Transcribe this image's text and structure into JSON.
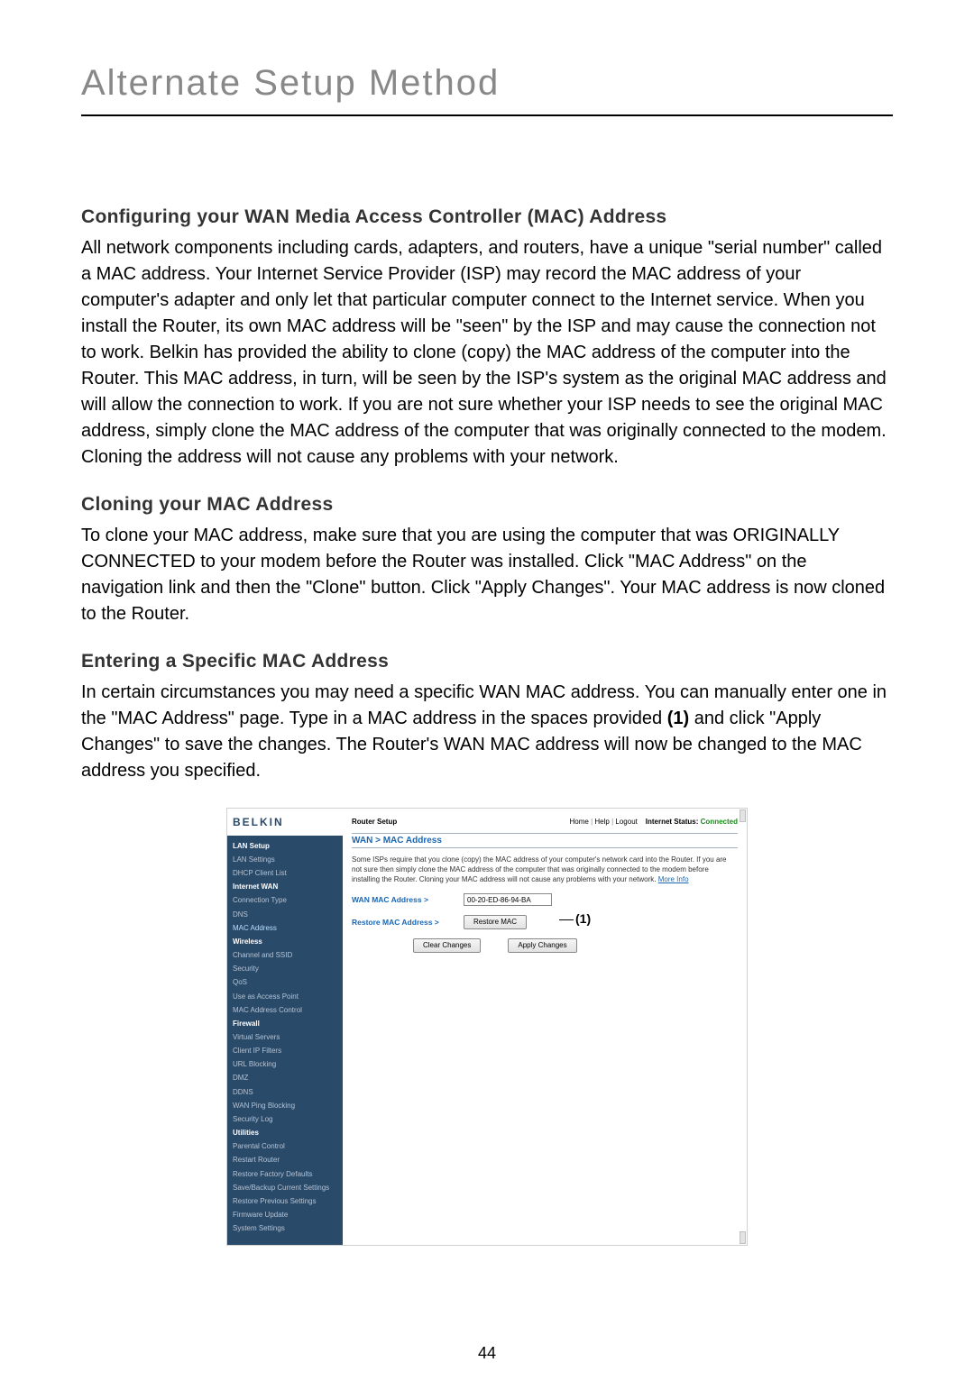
{
  "page": {
    "title": "Alternate Setup Method",
    "number": "44"
  },
  "sections": [
    {
      "heading": "Configuring your WAN Media Access Controller (MAC) Address",
      "body": "All network components including cards, adapters, and routers, have a unique \"serial number\" called a MAC address. Your Internet Service Provider (ISP) may record the MAC address of your computer's adapter and only let that particular computer connect to the Internet service. When you install the Router, its own MAC address will be \"seen\" by the ISP and may cause the connection not to work. Belkin has provided the ability to clone (copy) the MAC address of the computer into the Router. This MAC address, in turn, will be seen by the ISP's system as the original MAC address and will allow the connection to work. If you are not sure whether your ISP needs to see the original MAC address, simply clone the MAC address of the computer that was originally connected to the modem. Cloning the address will not cause any problems with your network."
    },
    {
      "heading": "Cloning your MAC Address",
      "body": "To clone your MAC address, make sure that you are using the computer that was ORIGINALLY CONNECTED to your modem before the Router was installed. Click \"MAC Address\" on the navigation link and then the \"Clone\" button. Click \"Apply Changes\". Your MAC address is now cloned to the Router."
    },
    {
      "heading": "Entering a Specific MAC Address",
      "body_pre": "In certain circumstances you may need a specific WAN MAC address. You can manually enter one in the \"MAC Address\" page. Type in a MAC address in the spaces provided ",
      "body_bold": "(1)",
      "body_post": " and click \"Apply Changes\" to save the changes. The Router's WAN MAC address will now be changed to the MAC address you specified."
    }
  ],
  "router": {
    "brand": "BELKIN",
    "header_label": "Router Setup",
    "links": {
      "home": "Home",
      "help": "Help",
      "logout": "Logout"
    },
    "status_label": "Internet Status:",
    "status_value": "Connected",
    "breadcrumb": "WAN > MAC Address",
    "description": "Some ISPs require that you clone (copy) the MAC address of your computer's network card into the Router. If you are not sure then simply clone the MAC address of the computer that was originally connected to the modem before installing the Router. Cloning your MAC address will not cause any problems with your network. ",
    "more_info": "More Info",
    "wan_mac_label": "WAN MAC Address >",
    "wan_mac_value": "00-20-ED-86-94-BA",
    "restore_mac_label": "Restore MAC Address >",
    "restore_btn": "Restore MAC",
    "clear_btn": "Clear Changes",
    "apply_btn": "Apply Changes",
    "callout1": "(1)",
    "sidebar": {
      "groups": [
        {
          "head": "LAN Setup",
          "items": [
            "LAN Settings",
            "DHCP Client List"
          ]
        },
        {
          "head": "Internet WAN",
          "items": [
            "Connection Type",
            "DNS",
            "MAC Address"
          ],
          "hl": "MAC Address"
        },
        {
          "head": "Wireless",
          "items": [
            "Channel and SSID",
            "Security",
            "QoS",
            "Use as Access Point",
            "MAC Address Control"
          ]
        },
        {
          "head": "Firewall",
          "items": [
            "Virtual Servers",
            "Client IP Filters",
            "URL Blocking",
            "DMZ",
            "DDNS",
            "WAN Ping Blocking",
            "Security Log"
          ]
        },
        {
          "head": "Utilities",
          "items": [
            "Parental Control",
            "Restart Router",
            "Restore Factory Defaults",
            "Save/Backup Current Settings",
            "Restore Previous Settings",
            "Firmware Update",
            "System Settings"
          ]
        }
      ]
    }
  }
}
